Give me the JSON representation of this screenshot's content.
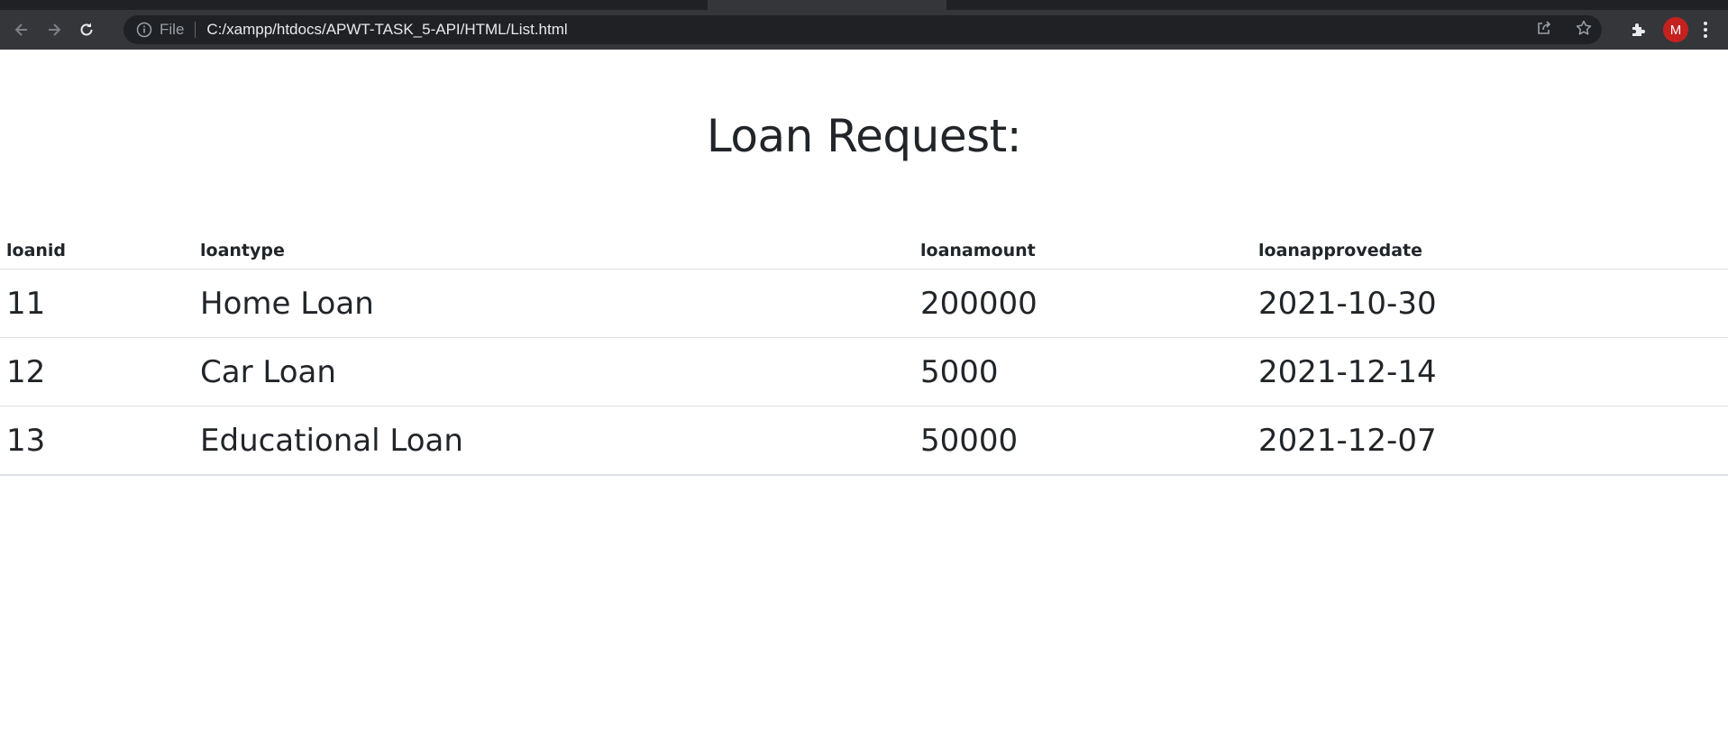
{
  "browser": {
    "scheme_label": "File",
    "url": "C:/xampp/htdocs/APWT-TASK_5-API/HTML/List.html",
    "profile_initial": "M",
    "icons": {
      "back": "back-arrow-icon",
      "forward": "forward-arrow-icon",
      "reload": "reload-icon",
      "info": "info-icon",
      "share": "share-icon",
      "bookmark": "star-icon",
      "extensions": "puzzle-icon",
      "menu": "kebab-menu-icon"
    },
    "colors": {
      "toolbar": "#35363a",
      "omnibox": "#202124",
      "avatar": "#c5221f"
    }
  },
  "page": {
    "title": "Loan Request:"
  },
  "table": {
    "headers": [
      "loanid",
      "loantype",
      "loanamount",
      "loanapprovedate"
    ],
    "rows": [
      [
        "11",
        "Home Loan",
        "200000",
        "2021-10-30"
      ],
      [
        "12",
        "Car Loan",
        "5000",
        "2021-12-14"
      ],
      [
        "13",
        "Educational Loan",
        "50000",
        "2021-12-07"
      ]
    ]
  }
}
